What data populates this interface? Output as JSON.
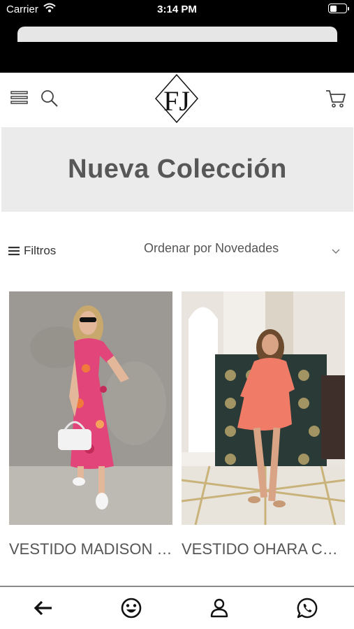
{
  "status_bar": {
    "carrier": "Carrier",
    "time": "3:14 PM",
    "battery_level": 0.45
  },
  "header": {
    "logo_text": "FJ",
    "icons": [
      "menu-icon",
      "search-icon",
      "cart-icon"
    ]
  },
  "banner": {
    "title": "Nueva Colección"
  },
  "toolbar": {
    "filters_label": "Filtros",
    "sort_label": "Ordenar por Novedades"
  },
  "products": [
    {
      "name": "VESTIDO MADISON FLORAL ROSA"
    },
    {
      "name": "VESTIDO OHARA CORAL"
    }
  ],
  "bottom_nav": {
    "icons": [
      "back-arrow-icon",
      "smiley-icon",
      "user-icon",
      "whatsapp-icon"
    ]
  },
  "colors": {
    "banner_bg": "#ebebeb",
    "banner_text": "#575757",
    "status_bg": "#000000"
  }
}
